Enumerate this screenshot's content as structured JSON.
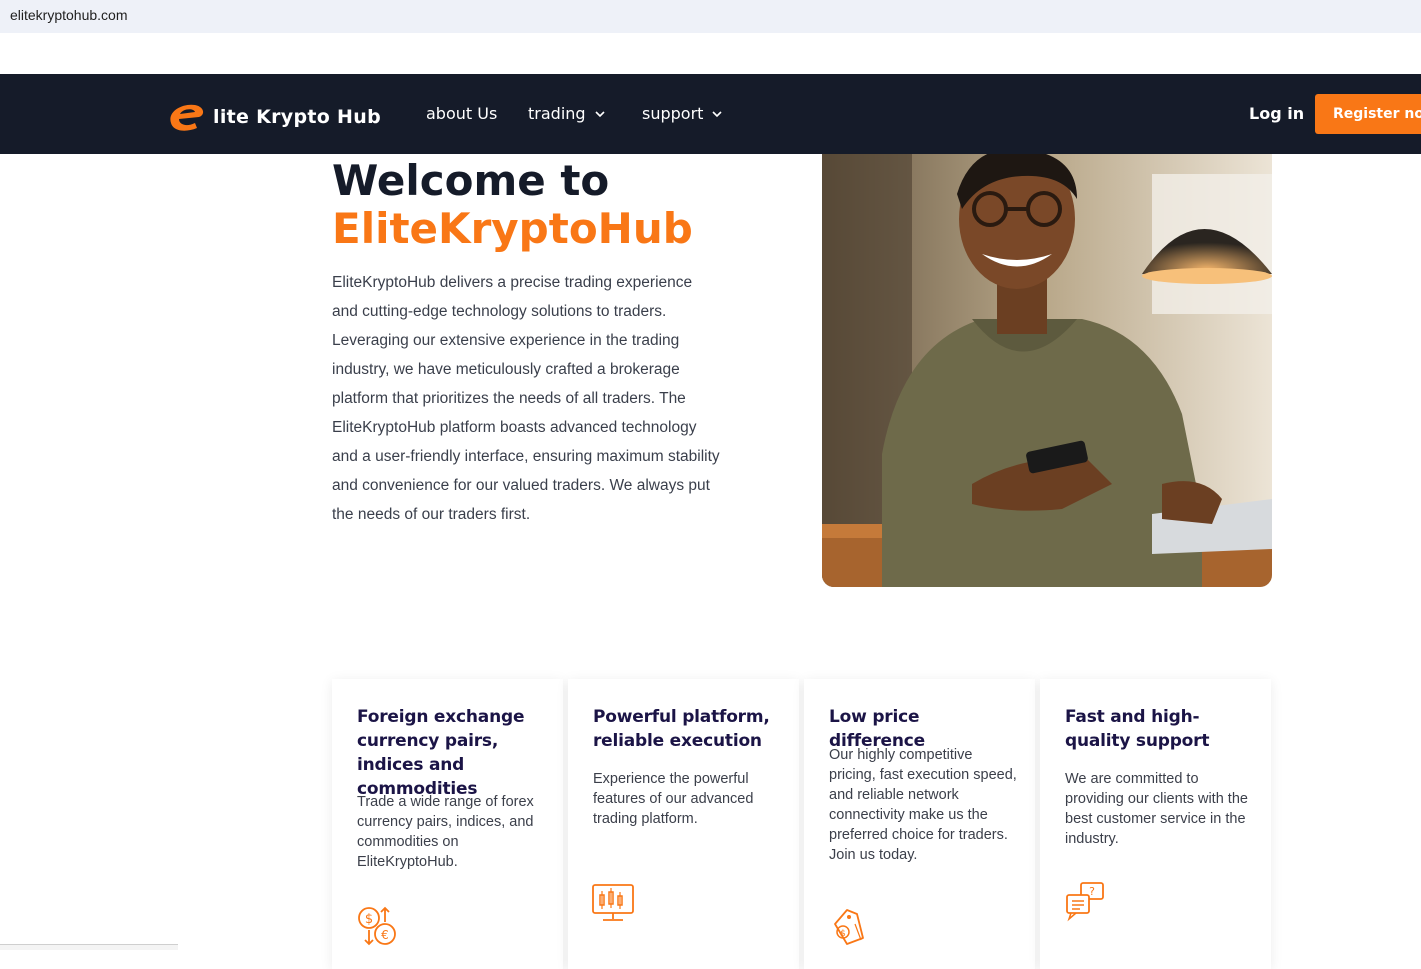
{
  "browser": {
    "url": "elitekryptohub.com"
  },
  "header": {
    "logo_text": "lite Krypto Hub",
    "nav": [
      {
        "label": "about Us"
      },
      {
        "label": "trading"
      },
      {
        "label": "support"
      }
    ],
    "login_label": "Log in",
    "register_label": "Register now"
  },
  "hero": {
    "title_line1": "Welcome to",
    "title_line2": "EliteKryptoHub",
    "description": "EliteKryptoHub delivers a precise trading experience and cutting-edge technology solutions to traders. Leveraging our extensive experience in the trading industry, we have meticulously crafted a brokerage platform that prioritizes the needs of all traders. The EliteKryptoHub platform boasts advanced technology and a user-friendly interface, ensuring maximum stability and convenience for our valued traders. We always put the needs of our traders first."
  },
  "features": [
    {
      "title": "Foreign exchange currency pairs, indices and commodities",
      "text": "Trade a wide range of forex currency pairs, indices, and commodities on EliteKryptoHub.",
      "icon": "currency-exchange-icon"
    },
    {
      "title": "Powerful platform, reliable execution",
      "text": "Experience the powerful features of our advanced trading platform.",
      "icon": "trading-monitor-icon"
    },
    {
      "title": "Low price difference",
      "text": "Our highly competitive pricing, fast execution speed, and reliable network connectivity make us the preferred choice for traders. Join us today.",
      "icon": "price-tag-icon"
    },
    {
      "title": "Fast and high-quality support",
      "text": "We are committed to providing our clients with the best customer service in the industry.",
      "icon": "support-chat-icon"
    }
  ],
  "colors": {
    "accent": "#f97716",
    "navbar": "#151b29",
    "heading": "#1b1446"
  }
}
